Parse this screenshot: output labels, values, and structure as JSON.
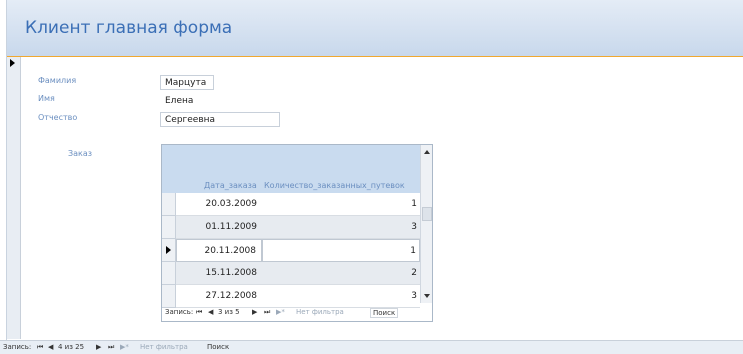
{
  "form": {
    "title": "Клиент главная форма",
    "fields": {
      "surname_label": "Фамилия",
      "surname_value": "Марцута",
      "name_label": "Имя",
      "name_value": "Елена",
      "patronymic_label": "Отчество",
      "patronymic_value": "Сергеевна"
    },
    "order_label": "Заказ"
  },
  "subform": {
    "columns": [
      "Дата_заказа",
      "Количество_заказанных_путевок"
    ],
    "rows": [
      {
        "date": "20.03.2009",
        "qty": "1"
      },
      {
        "date": "01.11.2009",
        "qty": "3"
      },
      {
        "date": "20.11.2008",
        "qty": "1"
      },
      {
        "date": "15.11.2008",
        "qty": "2"
      },
      {
        "date": "27.12.2008",
        "qty": "3"
      }
    ],
    "current_row_index": 2,
    "nav": {
      "label": "Запись:",
      "first": "⏮",
      "prev": "◀",
      "position": "3 из 5",
      "next": "▶",
      "last": "⏭",
      "new": "▶*",
      "filter": "Нет фильтра",
      "search": "Поиск"
    }
  },
  "main_nav": {
    "label": "Запись:",
    "first": "⏮",
    "prev": "◀",
    "position": "4 из 25",
    "next": "▶",
    "last": "⏭",
    "new": "▶*",
    "filter": "Нет фильтра",
    "search": "Поиск"
  },
  "colors": {
    "header_bg": "#c8d8ec",
    "title": "#3b6fb6",
    "label": "#6b8fc0",
    "accent_line": "#f0a830"
  }
}
